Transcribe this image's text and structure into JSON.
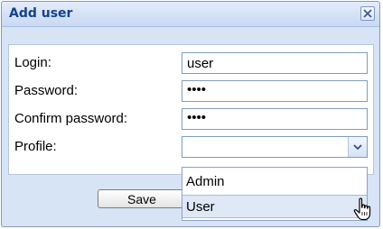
{
  "dialog": {
    "title": "Add user",
    "close_icon": "close-icon"
  },
  "form": {
    "login": {
      "label": "Login:",
      "value": "user"
    },
    "password": {
      "label": "Password:",
      "value": "••••"
    },
    "confirm_password": {
      "label": "Confirm password:",
      "value": "••••"
    },
    "profile": {
      "label": "Profile:",
      "value": "",
      "options": [
        "Admin",
        "User"
      ],
      "hovered_option": "User"
    }
  },
  "buttons": {
    "save_label": "Save"
  },
  "icons": {
    "dropdown": "chevron-down-icon",
    "cursor": "hand-pointer-icon"
  }
}
